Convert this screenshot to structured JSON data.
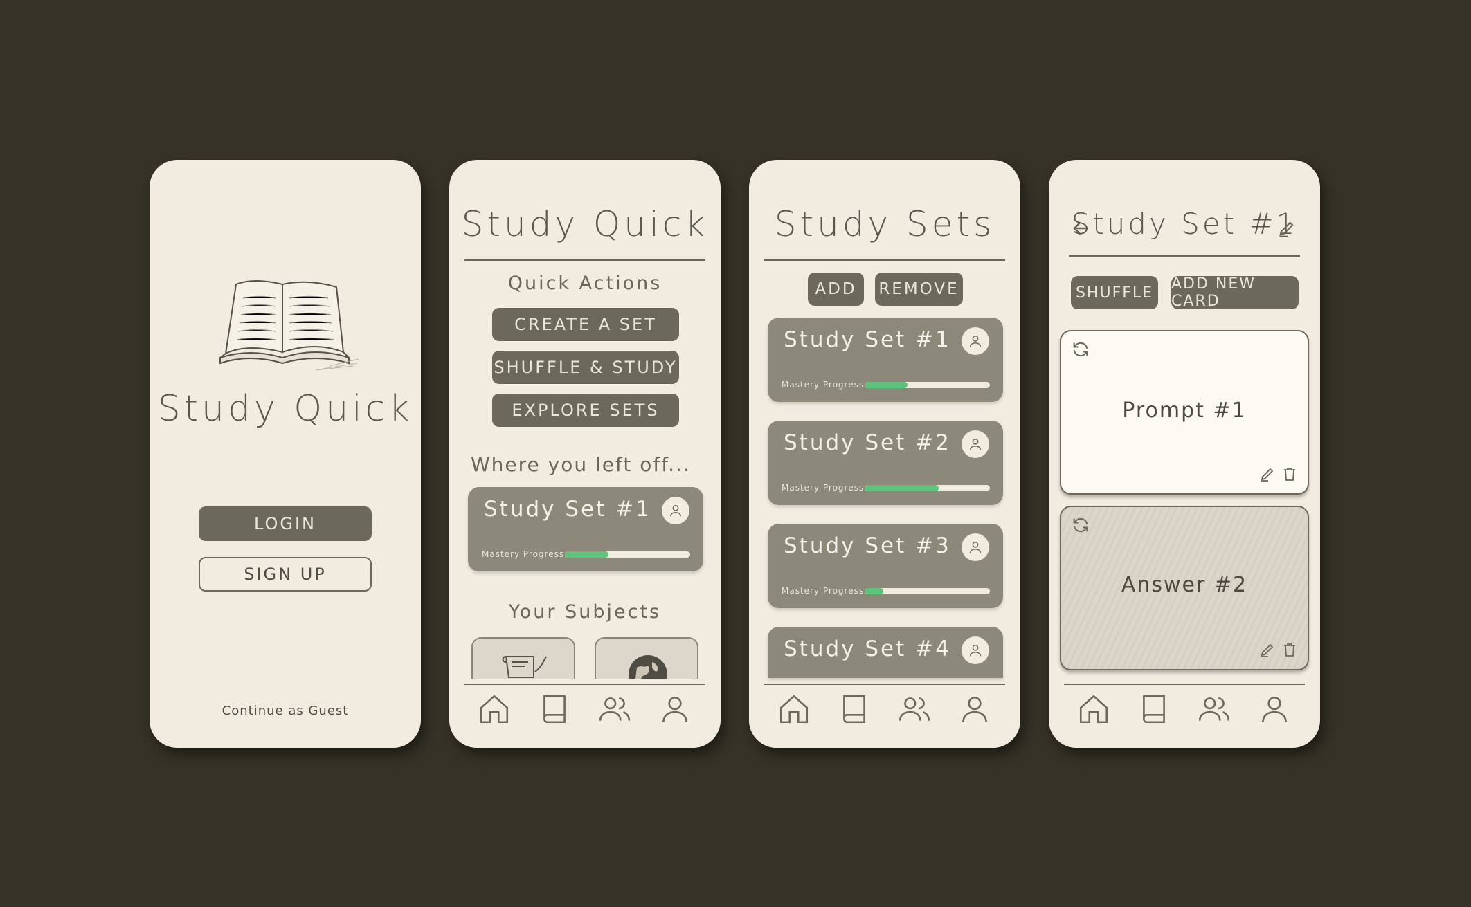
{
  "app_name": "Study Quick",
  "screen1": {
    "title": "Study Quick",
    "login": "LOGIN",
    "signup": "SIGN UP",
    "guest": "Continue as Guest"
  },
  "screen2": {
    "title": "Study Quick",
    "quick_actions": "Quick Actions",
    "create": "CREATE A SET",
    "shuffle": "SHUFFLE & STUDY",
    "explore": "EXPLORE SETS",
    "left_off": "Where you left off...",
    "recent_set": {
      "name": "Study Set #1",
      "mastery_label": "Mastery Progress:",
      "progress": 0.35
    },
    "subjects": "Your Subjects"
  },
  "screen3": {
    "title": "Study Sets",
    "add": "ADD",
    "remove": "REMOVE",
    "sets": [
      {
        "name": "Study Set #1",
        "mastery_label": "Mastery Progress:",
        "progress": 0.34
      },
      {
        "name": "Study Set #2",
        "mastery_label": "Mastery Progress:",
        "progress": 0.59
      },
      {
        "name": "Study Set #3",
        "mastery_label": "Mastery Progress:",
        "progress": 0.15
      },
      {
        "name": "Study Set #4"
      }
    ]
  },
  "screen4": {
    "title": "Study Set #1",
    "shuffle": "SHUFFLE",
    "add_card": "ADD NEW CARD",
    "cards": [
      {
        "text": "Prompt #1"
      },
      {
        "text": "Answer #2"
      }
    ]
  },
  "colors": {
    "background": "#363227",
    "phone": "#f1ebe0",
    "button": "#6c685c",
    "card": "#8c887a",
    "progress": "#5cc47a"
  },
  "icons": [
    "book-illustration",
    "home-icon",
    "book-icon",
    "users-icon",
    "user-icon",
    "arrow-left-icon",
    "pencil-icon",
    "trash-icon",
    "refresh-icon",
    "scroll-icon",
    "globe-icon"
  ]
}
